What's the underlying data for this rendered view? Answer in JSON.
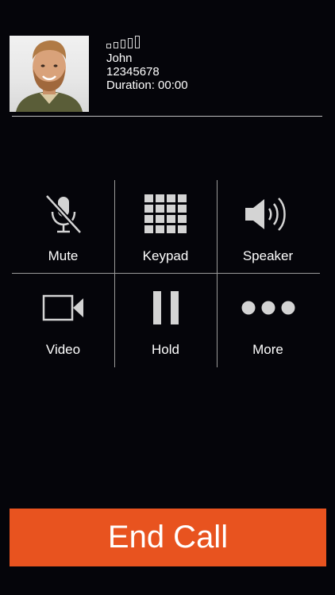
{
  "caller": {
    "name": "John",
    "number": "12345678",
    "duration": "Duration: 00:00",
    "signal_bars_total": 5,
    "signal_bars_filled": 0
  },
  "controls": [
    {
      "label": "Mute",
      "icon": "microphone-muted-icon"
    },
    {
      "label": "Keypad",
      "icon": "keypad-icon"
    },
    {
      "label": "Speaker",
      "icon": "speaker-icon"
    },
    {
      "label": "Video",
      "icon": "video-camera-icon"
    },
    {
      "label": "Hold",
      "icon": "pause-icon"
    },
    {
      "label": "More",
      "icon": "more-dots-icon"
    }
  ],
  "end_call": {
    "label": "End Call"
  },
  "colors": {
    "background": "#05050a",
    "end_call": "#e8531f",
    "icon": "#d4d4d4",
    "divider": "#9a9a9a"
  }
}
